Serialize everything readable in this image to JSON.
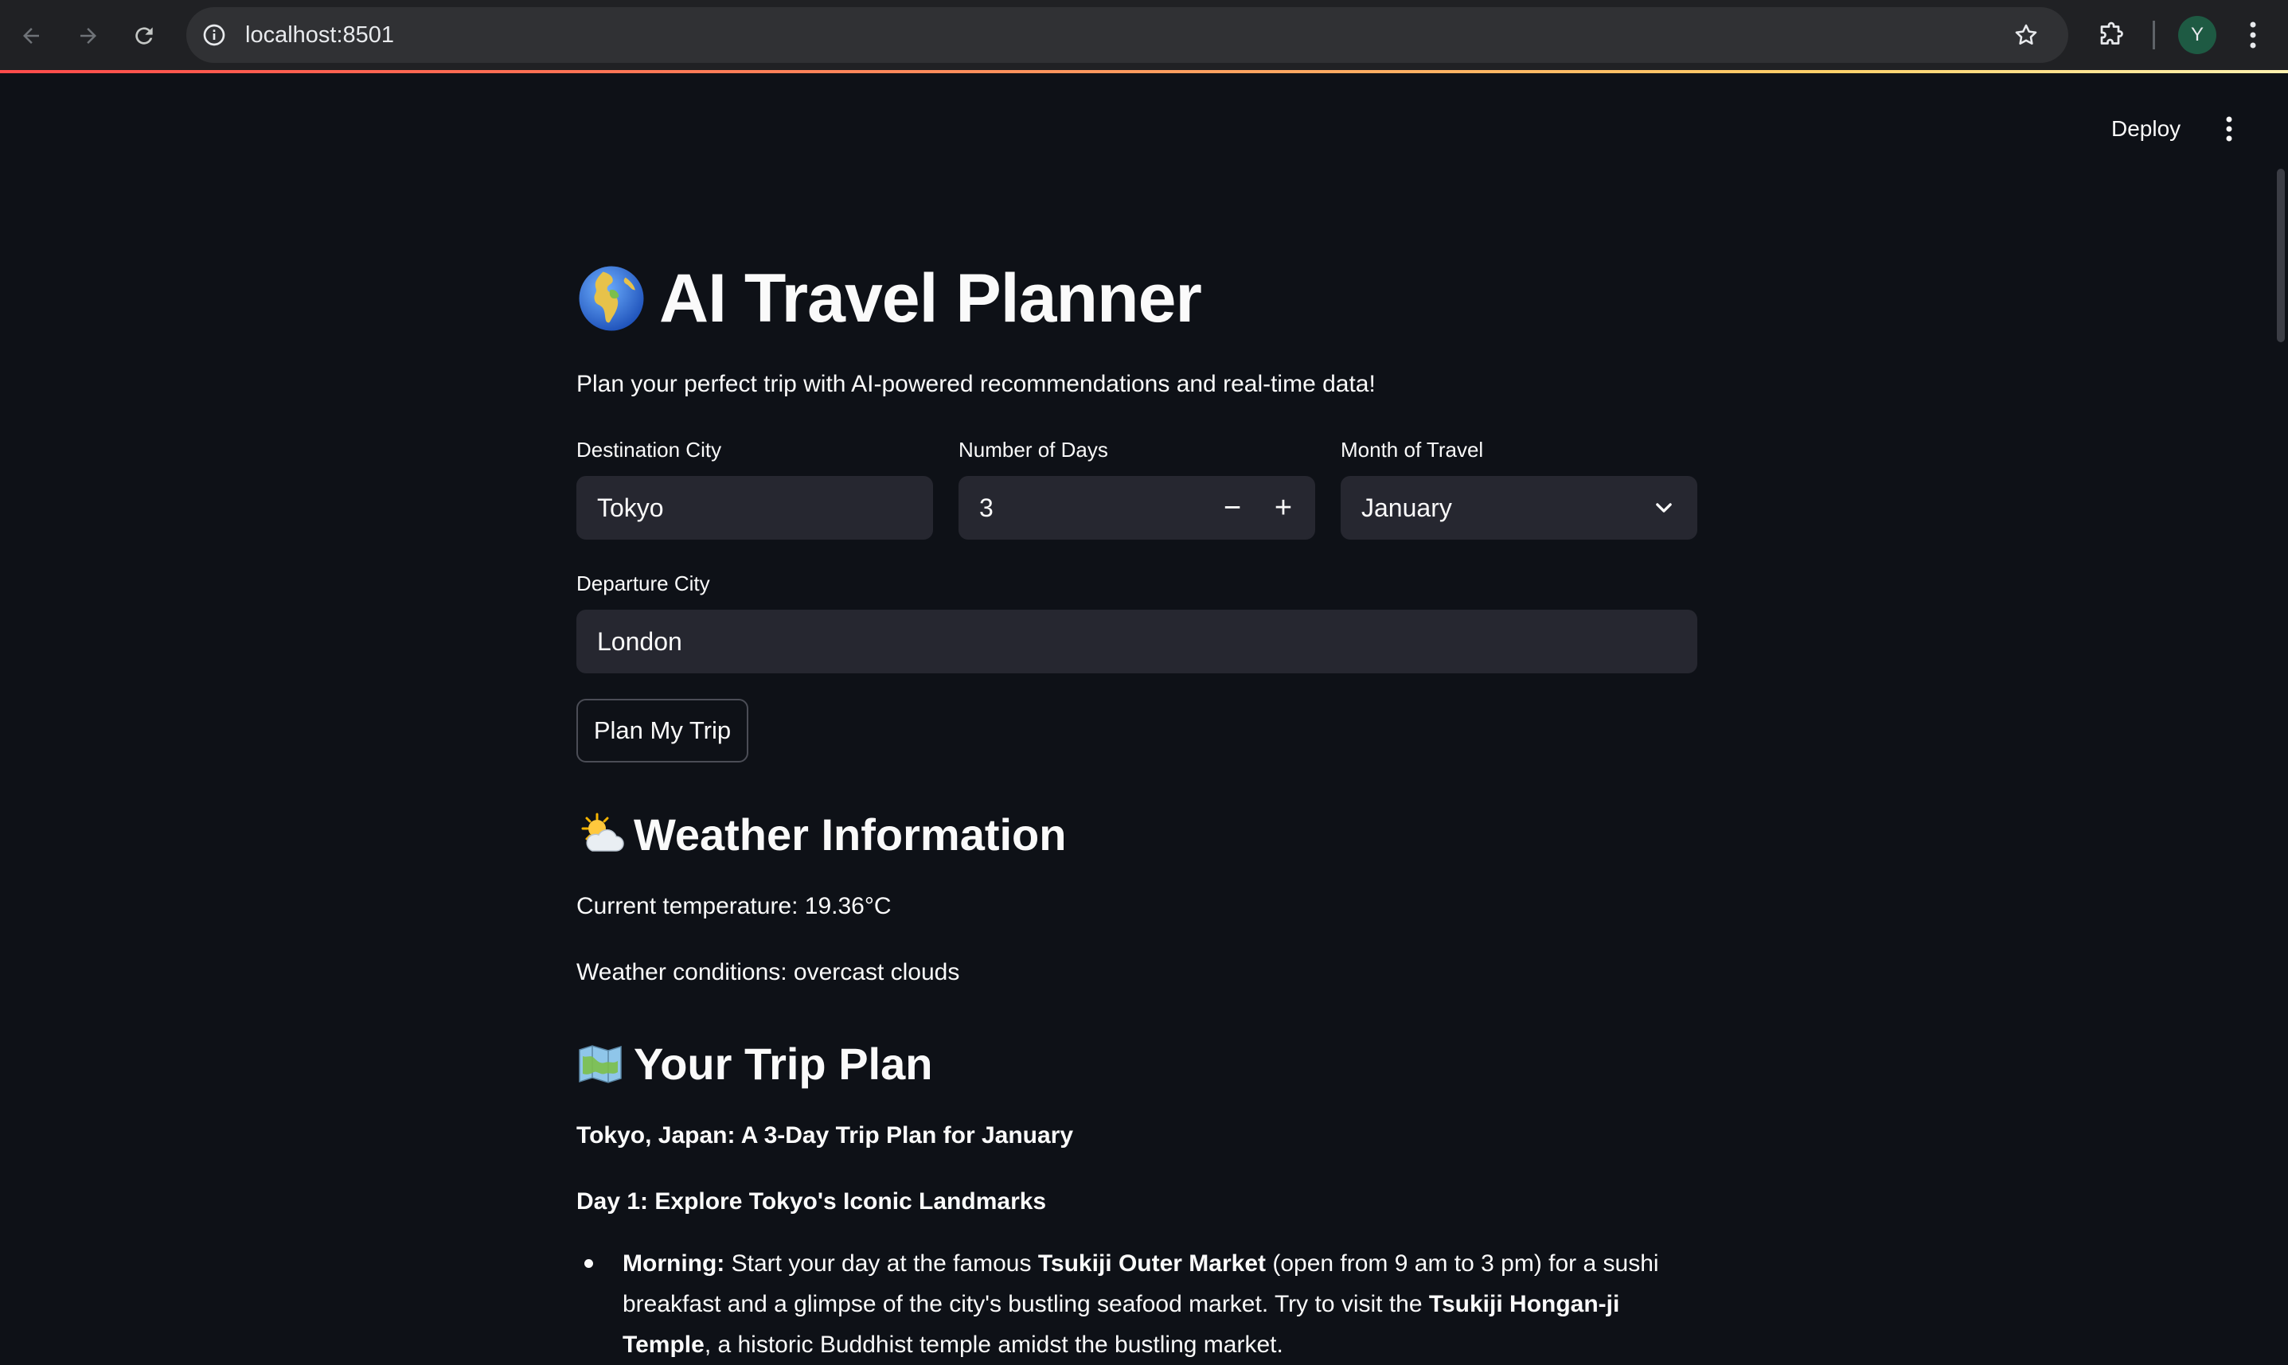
{
  "browser": {
    "url": "localhost:8501",
    "profile_initial": "Y",
    "icons": {
      "back": "arrow-left-icon",
      "forward": "arrow-right-icon",
      "reload": "reload-icon",
      "site_info": "info-icon",
      "bookmark": "star-icon",
      "extensions": "puzzle-icon",
      "menu": "vertical-dots-icon"
    }
  },
  "app_header": {
    "deploy_label": "Deploy",
    "menu_icon": "vertical-dots-icon"
  },
  "page": {
    "title": "AI Travel Planner",
    "title_icon": "globe-emoji",
    "subtitle": "Plan your perfect trip with AI-powered recommendations and real-time data!"
  },
  "form": {
    "destination": {
      "label": "Destination City",
      "value": "Tokyo"
    },
    "days": {
      "label": "Number of Days",
      "value": "3",
      "decrement": "−",
      "increment": "+"
    },
    "month": {
      "label": "Month of Travel",
      "value": "January"
    },
    "departure": {
      "label": "Departure City",
      "value": "London"
    },
    "submit_label": "Plan My Trip"
  },
  "weather": {
    "heading": "Weather Information",
    "heading_icon": "sun-behind-cloud-emoji",
    "temperature": "Current temperature: 19.36°C",
    "conditions": "Weather conditions: overcast clouds"
  },
  "trip_plan": {
    "heading": "Your Trip Plan",
    "heading_icon": "map-emoji",
    "intro": "Tokyo, Japan: A 3-Day Trip Plan for January",
    "day1_heading": "Day 1: Explore Tokyo's Iconic Landmarks",
    "morning": {
      "label": "Morning:",
      "t1": " Start your day at the famous ",
      "b1": "Tsukiji Outer Market",
      "t2": " (open from 9 am to 3 pm) for a sushi breakfast and a glimpse of the city's bustling seafood market. Try to visit the ",
      "b2": "Tsukiji Hongan-ji Temple",
      "t3": ", a historic Buddhist temple amidst the bustling market."
    }
  },
  "colors": {
    "background": "#0e1117",
    "input_bg": "#262730",
    "text": "#fafafa",
    "chrome_bg": "#202124",
    "accent": "#ff4b4b"
  }
}
